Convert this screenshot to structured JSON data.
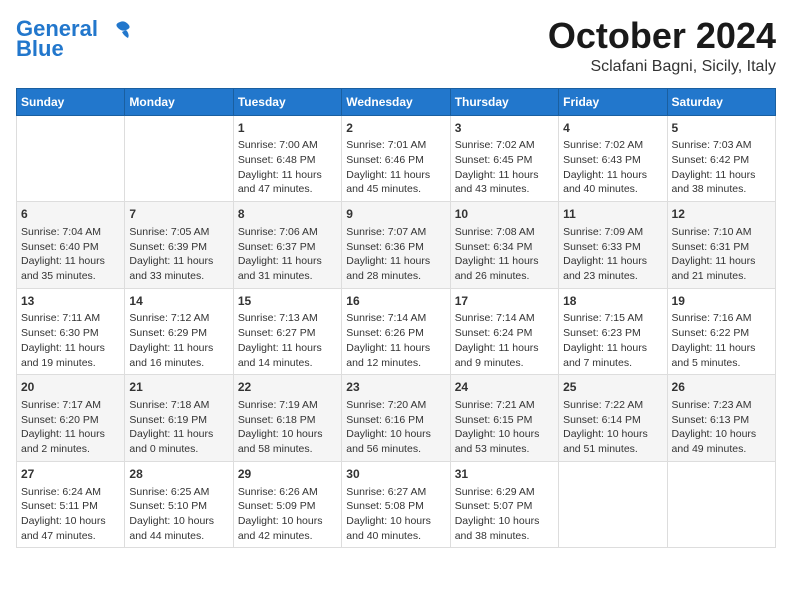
{
  "header": {
    "logo_general": "General",
    "logo_blue": "Blue",
    "month_title": "October 2024",
    "location": "Sclafani Bagni, Sicily, Italy"
  },
  "weekdays": [
    "Sunday",
    "Monday",
    "Tuesday",
    "Wednesday",
    "Thursday",
    "Friday",
    "Saturday"
  ],
  "weeks": [
    [
      {
        "day": "",
        "content": ""
      },
      {
        "day": "",
        "content": ""
      },
      {
        "day": "1",
        "content": "Sunrise: 7:00 AM\nSunset: 6:48 PM\nDaylight: 11 hours\nand 47 minutes."
      },
      {
        "day": "2",
        "content": "Sunrise: 7:01 AM\nSunset: 6:46 PM\nDaylight: 11 hours\nand 45 minutes."
      },
      {
        "day": "3",
        "content": "Sunrise: 7:02 AM\nSunset: 6:45 PM\nDaylight: 11 hours\nand 43 minutes."
      },
      {
        "day": "4",
        "content": "Sunrise: 7:02 AM\nSunset: 6:43 PM\nDaylight: 11 hours\nand 40 minutes."
      },
      {
        "day": "5",
        "content": "Sunrise: 7:03 AM\nSunset: 6:42 PM\nDaylight: 11 hours\nand 38 minutes."
      }
    ],
    [
      {
        "day": "6",
        "content": "Sunrise: 7:04 AM\nSunset: 6:40 PM\nDaylight: 11 hours\nand 35 minutes."
      },
      {
        "day": "7",
        "content": "Sunrise: 7:05 AM\nSunset: 6:39 PM\nDaylight: 11 hours\nand 33 minutes."
      },
      {
        "day": "8",
        "content": "Sunrise: 7:06 AM\nSunset: 6:37 PM\nDaylight: 11 hours\nand 31 minutes."
      },
      {
        "day": "9",
        "content": "Sunrise: 7:07 AM\nSunset: 6:36 PM\nDaylight: 11 hours\nand 28 minutes."
      },
      {
        "day": "10",
        "content": "Sunrise: 7:08 AM\nSunset: 6:34 PM\nDaylight: 11 hours\nand 26 minutes."
      },
      {
        "day": "11",
        "content": "Sunrise: 7:09 AM\nSunset: 6:33 PM\nDaylight: 11 hours\nand 23 minutes."
      },
      {
        "day": "12",
        "content": "Sunrise: 7:10 AM\nSunset: 6:31 PM\nDaylight: 11 hours\nand 21 minutes."
      }
    ],
    [
      {
        "day": "13",
        "content": "Sunrise: 7:11 AM\nSunset: 6:30 PM\nDaylight: 11 hours\nand 19 minutes."
      },
      {
        "day": "14",
        "content": "Sunrise: 7:12 AM\nSunset: 6:29 PM\nDaylight: 11 hours\nand 16 minutes."
      },
      {
        "day": "15",
        "content": "Sunrise: 7:13 AM\nSunset: 6:27 PM\nDaylight: 11 hours\nand 14 minutes."
      },
      {
        "day": "16",
        "content": "Sunrise: 7:14 AM\nSunset: 6:26 PM\nDaylight: 11 hours\nand 12 minutes."
      },
      {
        "day": "17",
        "content": "Sunrise: 7:14 AM\nSunset: 6:24 PM\nDaylight: 11 hours\nand 9 minutes."
      },
      {
        "day": "18",
        "content": "Sunrise: 7:15 AM\nSunset: 6:23 PM\nDaylight: 11 hours\nand 7 minutes."
      },
      {
        "day": "19",
        "content": "Sunrise: 7:16 AM\nSunset: 6:22 PM\nDaylight: 11 hours\nand 5 minutes."
      }
    ],
    [
      {
        "day": "20",
        "content": "Sunrise: 7:17 AM\nSunset: 6:20 PM\nDaylight: 11 hours\nand 2 minutes."
      },
      {
        "day": "21",
        "content": "Sunrise: 7:18 AM\nSunset: 6:19 PM\nDaylight: 11 hours\nand 0 minutes."
      },
      {
        "day": "22",
        "content": "Sunrise: 7:19 AM\nSunset: 6:18 PM\nDaylight: 10 hours\nand 58 minutes."
      },
      {
        "day": "23",
        "content": "Sunrise: 7:20 AM\nSunset: 6:16 PM\nDaylight: 10 hours\nand 56 minutes."
      },
      {
        "day": "24",
        "content": "Sunrise: 7:21 AM\nSunset: 6:15 PM\nDaylight: 10 hours\nand 53 minutes."
      },
      {
        "day": "25",
        "content": "Sunrise: 7:22 AM\nSunset: 6:14 PM\nDaylight: 10 hours\nand 51 minutes."
      },
      {
        "day": "26",
        "content": "Sunrise: 7:23 AM\nSunset: 6:13 PM\nDaylight: 10 hours\nand 49 minutes."
      }
    ],
    [
      {
        "day": "27",
        "content": "Sunrise: 6:24 AM\nSunset: 5:11 PM\nDaylight: 10 hours\nand 47 minutes."
      },
      {
        "day": "28",
        "content": "Sunrise: 6:25 AM\nSunset: 5:10 PM\nDaylight: 10 hours\nand 44 minutes."
      },
      {
        "day": "29",
        "content": "Sunrise: 6:26 AM\nSunset: 5:09 PM\nDaylight: 10 hours\nand 42 minutes."
      },
      {
        "day": "30",
        "content": "Sunrise: 6:27 AM\nSunset: 5:08 PM\nDaylight: 10 hours\nand 40 minutes."
      },
      {
        "day": "31",
        "content": "Sunrise: 6:29 AM\nSunset: 5:07 PM\nDaylight: 10 hours\nand 38 minutes."
      },
      {
        "day": "",
        "content": ""
      },
      {
        "day": "",
        "content": ""
      }
    ]
  ]
}
